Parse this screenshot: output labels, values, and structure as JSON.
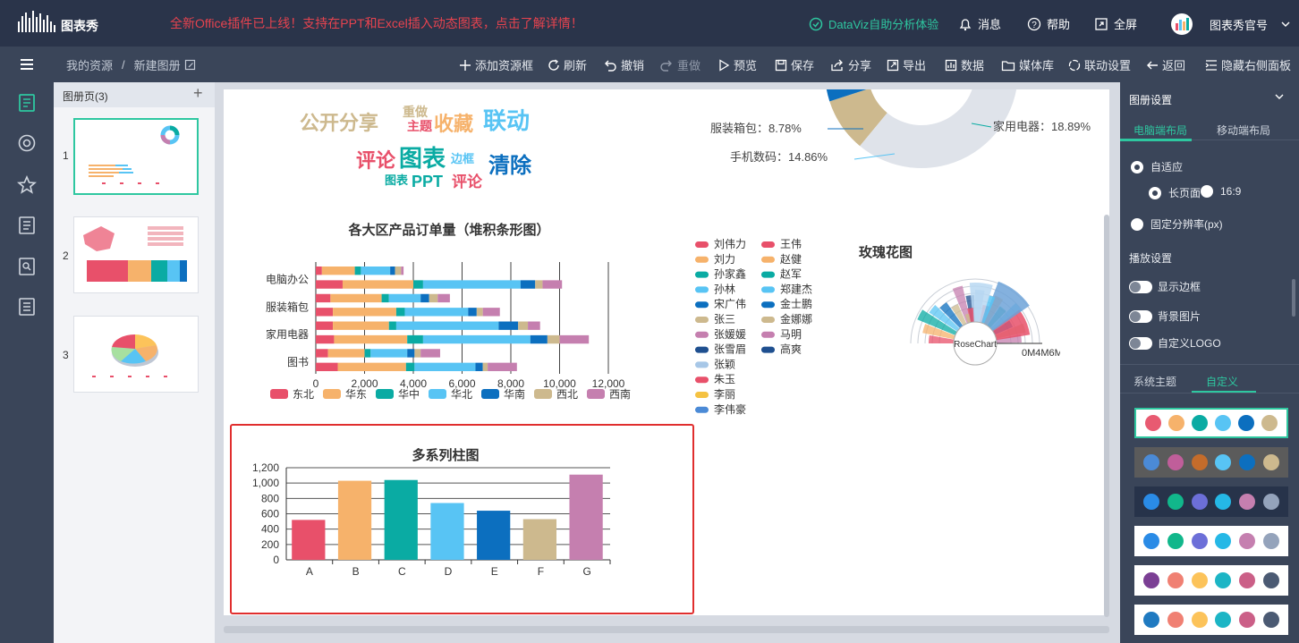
{
  "header": {
    "logo_text": "图表秀",
    "promo": "全新Office插件已上线！支持在PPT和Excel插入动态图表，点击了解详情！",
    "links": [
      "DataViz自助分析体验",
      "消息",
      "帮助",
      "全屏"
    ],
    "user": "图表秀官号"
  },
  "toolbar": {
    "breadcrumb": [
      "我的资源",
      "/",
      "新建图册"
    ],
    "actions": [
      "添加资源框",
      "刷新",
      "撤销",
      "重做",
      "预览",
      "保存",
      "分享",
      "导出",
      "数据",
      "媒体库",
      "联动设置",
      "返回",
      "隐藏右侧面板"
    ]
  },
  "pages_panel": {
    "title": "图册页(3)",
    "add_label": "+",
    "page_numbers": [
      "1",
      "2",
      "3"
    ]
  },
  "right_panel": {
    "title": "图册设置",
    "layout_tabs": [
      "电脑端布局",
      "移动端布局"
    ],
    "adaptive": "自适应",
    "long_page": "长页面",
    "ratio_169": "16:9",
    "fixed_resolution": "固定分辨率(px)",
    "play_settings": "播放设置",
    "toggles": [
      "显示边框",
      "背景图片",
      "自定义LOGO"
    ],
    "theme_tabs": [
      "系统主题",
      "自定义"
    ],
    "themes": [
      {
        "bg": "#ffffff",
        "colors": [
          "#e85a71",
          "#f6b26b",
          "#0aaba3",
          "#58c4f4",
          "#0c6fbf",
          "#cdb98e"
        ]
      },
      {
        "bg": "#5b5b5b",
        "colors": [
          "#4b8ad6",
          "#c05e9a",
          "#c46c2b",
          "#58c4f4",
          "#0c6fbf",
          "#cdb98e"
        ]
      },
      {
        "bg": "#27334a",
        "colors": [
          "#2a8be6",
          "#11b78b",
          "#6c6fd8",
          "#25b8e6",
          "#c57faf",
          "#94a3bb"
        ]
      },
      {
        "bg": "#ffffff",
        "colors": [
          "#2a8be6",
          "#11b78b",
          "#6c6fd8",
          "#25b8e6",
          "#c57faf",
          "#94a3bb"
        ]
      },
      {
        "bg": "#ffffff",
        "colors": [
          "#7b3f94",
          "#f08073",
          "#fcc35a",
          "#1cb5c5",
          "#cb5f87",
          "#4b5a73"
        ]
      },
      {
        "bg": "#ffffff",
        "colors": [
          "#1f7ac1",
          "#f08073",
          "#fcc35a",
          "#1cb5c5",
          "#cb5f87",
          "#4b5a73"
        ]
      }
    ]
  },
  "wordcloud": {
    "words": [
      "公开分享",
      "重做",
      "主题",
      "收藏",
      "联动",
      "评论",
      "图表",
      "边框",
      "清除",
      "图表",
      "PPT",
      "评论"
    ]
  },
  "donut": {
    "labels": [
      "服装箱包：8.78%",
      "手机数码：14.86%",
      "家用电器：18.89%"
    ]
  },
  "chart_data": [
    {
      "type": "bar",
      "orientation": "horizontal",
      "stacked": true,
      "title": "各大区产品订单量（堆积条形图）",
      "categories": [
        "电脑办公",
        "服装箱包",
        "家用电器",
        "图书"
      ],
      "x_ticks": [
        "0",
        "2,000",
        "4,000",
        "6,000",
        "8,000",
        "10,000",
        "12,000"
      ],
      "xlim": [
        0,
        12000
      ],
      "legend": "bottom",
      "series": [
        {
          "name": "东北",
          "color": "#e8506a",
          "values": [
            [
              250,
              1100
            ],
            [
              600,
              700
            ],
            [
              700,
              750
            ],
            [
              500,
              900
            ]
          ]
        },
        {
          "name": "华东",
          "color": "#f6b26b",
          "values": [
            [
              1350,
              2900
            ],
            [
              2100,
              2600
            ],
            [
              2300,
              3000
            ],
            [
              1500,
              2800
            ]
          ]
        },
        {
          "name": "华中",
          "color": "#0aaba3",
          "values": [
            [
              250,
              400
            ],
            [
              300,
              350
            ],
            [
              300,
              650
            ],
            [
              250,
              350
            ]
          ]
        },
        {
          "name": "华北",
          "color": "#58c4f4",
          "values": [
            [
              1200,
              4000
            ],
            [
              1300,
              2600
            ],
            [
              4200,
              4400
            ],
            [
              1500,
              2500
            ]
          ]
        },
        {
          "name": "华南",
          "color": "#0c6fbf",
          "values": [
            [
              200,
              600
            ],
            [
              350,
              350
            ],
            [
              800,
              700
            ],
            [
              300,
              300
            ]
          ]
        },
        {
          "name": "西北",
          "color": "#cdb98e",
          "values": [
            [
              250,
              300
            ],
            [
              350,
              250
            ],
            [
              400,
              500
            ],
            [
              250,
              200
            ]
          ]
        },
        {
          "name": "西南",
          "color": "#c57faf",
          "values": [
            [
              100,
              800
            ],
            [
              500,
              700
            ],
            [
              500,
              1200
            ],
            [
              800,
              1200
            ]
          ]
        }
      ]
    },
    {
      "type": "bar",
      "title": "多系列柱图",
      "categories": [
        "A",
        "B",
        "C",
        "D",
        "E",
        "F",
        "G"
      ],
      "values": [
        520,
        1030,
        1040,
        740,
        640,
        530,
        1110
      ],
      "colors": [
        "#e8506a",
        "#f6b26b",
        "#0aaba3",
        "#58c4f4",
        "#0c6fbf",
        "#cdb98e",
        "#c57faf"
      ],
      "y_ticks": [
        "0",
        "200",
        "400",
        "600",
        "800",
        "1,000",
        "1,200"
      ],
      "ylim": [
        0,
        1200
      ]
    },
    {
      "type": "pie",
      "variant": "rose",
      "title": "玫瑰花图",
      "center_label": "RoseChart",
      "axis_label": "0M4M6M",
      "legend": "left",
      "legend_items": [
        {
          "name": "刘伟力",
          "color": "#e8506a"
        },
        {
          "name": "王伟",
          "color": "#e8506a"
        },
        {
          "name": "刘力",
          "color": "#f6b26b"
        },
        {
          "name": "赵健",
          "color": "#f6b26b"
        },
        {
          "name": "孙家鑫",
          "color": "#0aaba3"
        },
        {
          "name": "赵军",
          "color": "#0aaba3"
        },
        {
          "name": "孙林",
          "color": "#58c4f4"
        },
        {
          "name": "郑建杰",
          "color": "#58c4f4"
        },
        {
          "name": "宋广伟",
          "color": "#0c6fbf"
        },
        {
          "name": "金士鹏",
          "color": "#0c6fbf"
        },
        {
          "name": "张三",
          "color": "#cdb98e"
        },
        {
          "name": "金娜娜",
          "color": "#cdb98e"
        },
        {
          "name": "张媛媛",
          "color": "#c57faf"
        },
        {
          "name": "马明",
          "color": "#c57faf"
        },
        {
          "name": "张雪眉",
          "color": "#1e4f8f"
        },
        {
          "name": "高爽",
          "color": "#1e4f8f"
        },
        {
          "name": "张颖",
          "color": "#a7c7e7"
        },
        {
          "name": "朱玉",
          "color": "#e8506a"
        },
        {
          "name": "李丽",
          "color": "#f5c242"
        },
        {
          "name": "李伟豪",
          "color": "#4b8ad6"
        }
      ]
    }
  ]
}
